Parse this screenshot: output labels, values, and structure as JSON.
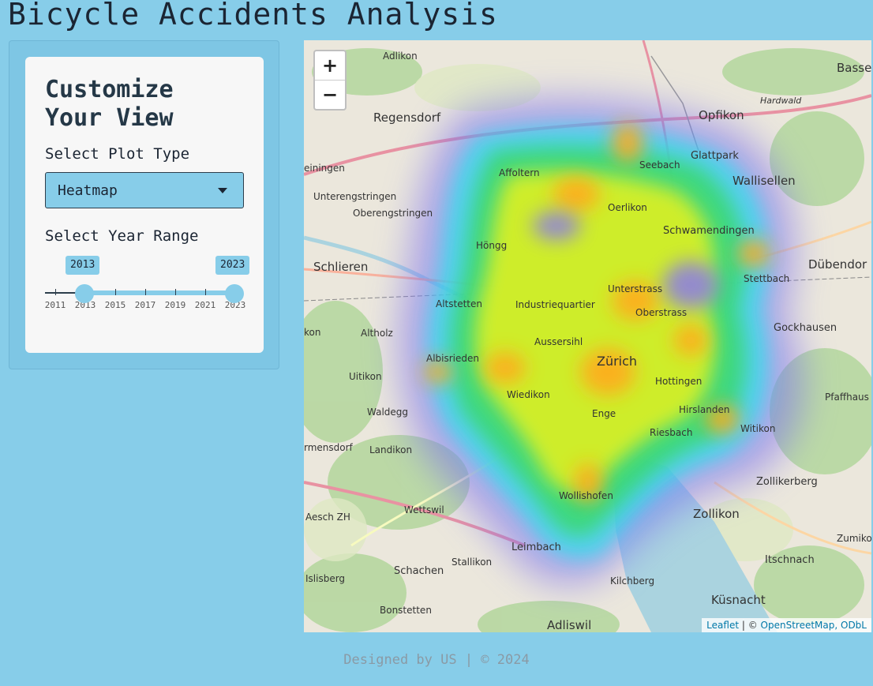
{
  "app": {
    "title": "Bicycle Accidents Analysis"
  },
  "sidebar": {
    "card_title": "Customize Your View",
    "plot_type_label": "Select Plot Type",
    "plot_type_value": "Heatmap",
    "year_range_label": "Select Year Range",
    "year_range": {
      "from": "2013",
      "to": "2023",
      "min": 2011,
      "max": 2024
    },
    "ticks": [
      "2011",
      "2013",
      "2015",
      "2017",
      "2019",
      "2021",
      "2023"
    ]
  },
  "map": {
    "zoom_in": "+",
    "zoom_out": "−",
    "attribution": {
      "leaflet": "Leaflet",
      "sep": " | © ",
      "osm": "OpenStreetMap, ODbL"
    },
    "places": {
      "adlikon": "Adlikon",
      "regensdorf": "Regensdorf",
      "opfikon": "Opfikon",
      "bassersdorf": "Basse",
      "glattpark": "Glattpark",
      "wallisellen": "Wallisellen",
      "einingen": "einingen",
      "affoltern": "Affoltern",
      "seebach": "Seebach",
      "unterengstringen": "Unterengstringen",
      "oberengstringen": "Oberengstringen",
      "oerlikon": "Oerlikon",
      "schwamendingen": "Schwamendingen",
      "dubendorf": "Dübendor",
      "schlieren": "Schlieren",
      "hongg": "Höngg",
      "stettbach": "Stettbach",
      "unterstrass": "Unterstrass",
      "altstetten": "Altstetten",
      "industriequartier": "Industriequartier",
      "oberstrass": "Oberstrass",
      "gockhausen": "Gockhausen",
      "aussersihl": "Aussersihl",
      "altholz": "Altholz",
      "uitikon": "Uitikon",
      "albisrieden": "Albisrieden",
      "zurich": "Zürich",
      "hottingen": "Hottingen",
      "pfaffhausen": "Pfaffhaus",
      "waldegg": "Waldegg",
      "wiedikon": "Wiedikon",
      "enge": "Enge",
      "hirslanden": "Hirslanden",
      "witikon": "Witikon",
      "riesbach": "Riesbach",
      "landikon": "Landikon",
      "birmensdorf": "rmensdorf",
      "zollikerberg": "Zollikerberg",
      "wollishofen": "Wollishofen",
      "wettswil": "Wettswil",
      "aesch": "Aesch ZH",
      "zollikon": "Zollikon",
      "zumikon": "Zumiko",
      "leimbach": "Leimbach",
      "stallikon": "Stallikon",
      "itschnach": "Itschnach",
      "schachen": "Schachen",
      "islisberg": "Islisberg",
      "kilchberg": "Kilchberg",
      "kusnacht": "Küsnacht",
      "bonstetten": "Bonstetten",
      "adliswil": "Adliswil",
      "hardwald": "Hardwald",
      "kon": "kon"
    }
  },
  "footer": {
    "text": "Designed by US | © 2024"
  }
}
